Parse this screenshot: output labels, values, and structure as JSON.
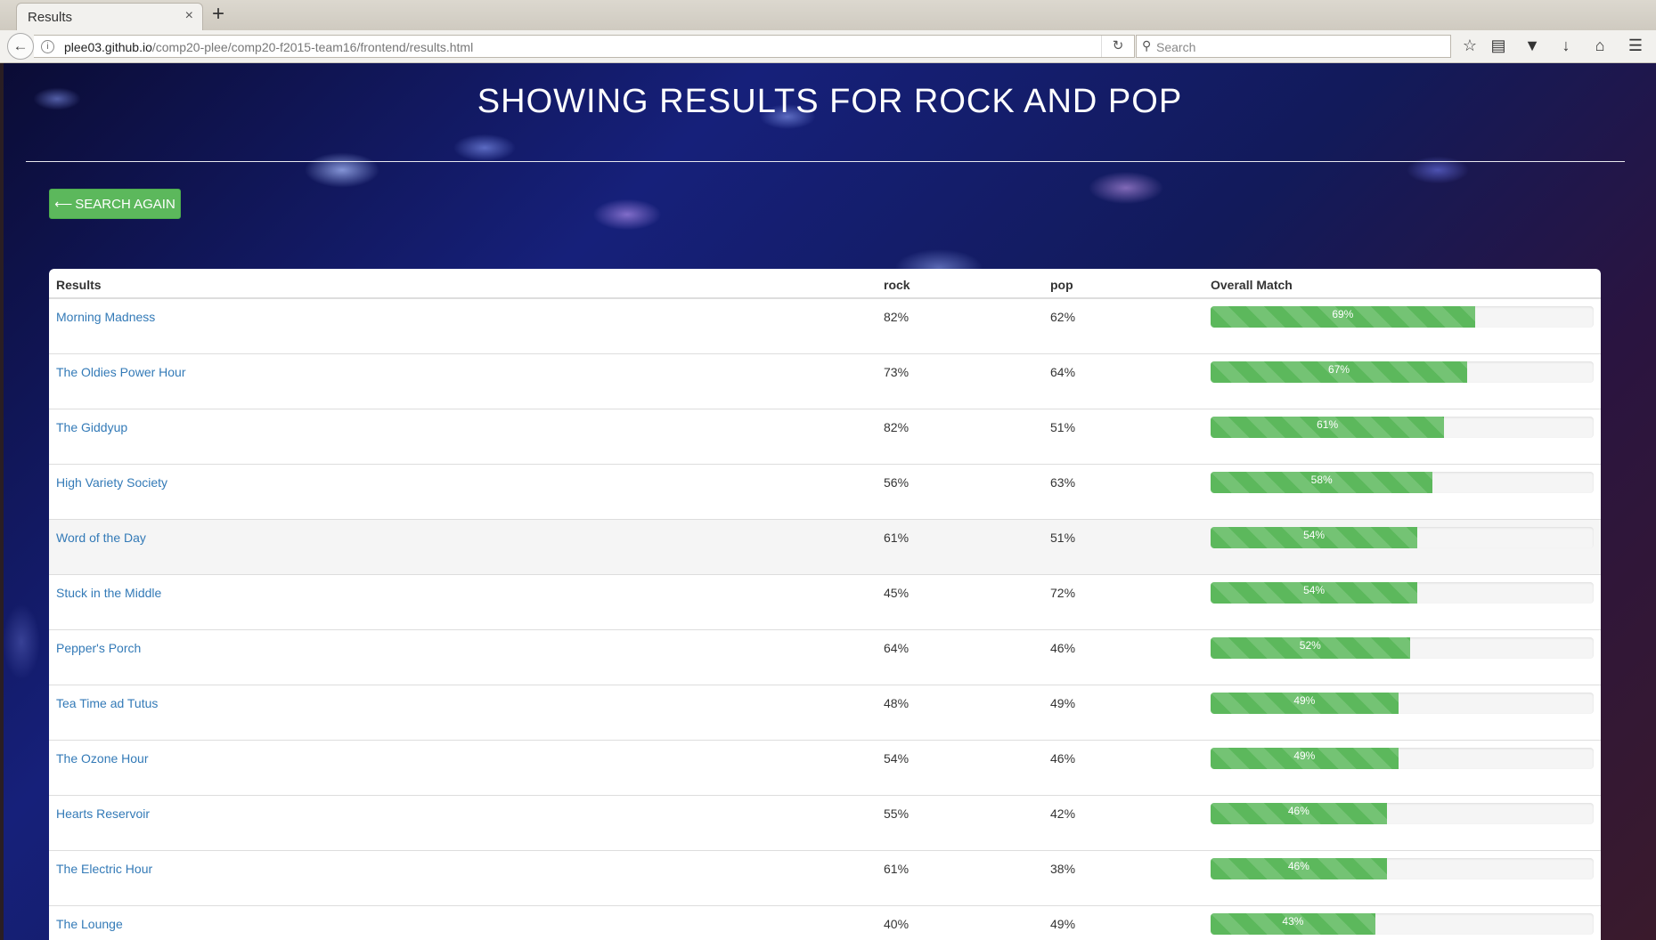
{
  "browser": {
    "tab_title": "Results",
    "tab_close": "×",
    "new_tab": "+",
    "url_host": "plee03.github.io",
    "url_path": "/comp20-plee/comp20-f2015-team16/frontend/results.html",
    "search_placeholder": "Search",
    "icons": [
      "back-arrow-icon",
      "info-icon",
      "reload-icon",
      "search-icon",
      "bookmark-star-icon",
      "reading-list-icon",
      "pocket-icon",
      "download-icon",
      "home-icon",
      "menu-icon"
    ]
  },
  "page": {
    "header": "SHOWING RESULTS FOR ROCK AND POP",
    "search_again_label": "SEARCH AGAIN",
    "search_again_icon": "arrow-left-icon",
    "table": {
      "columns": [
        "Results",
        "rock",
        "pop",
        "Overall Match"
      ],
      "rows": [
        {
          "name": "Morning Madness",
          "rock": "82%",
          "pop": "62%",
          "match": "69%",
          "match_value": 69
        },
        {
          "name": "The Oldies Power Hour",
          "rock": "73%",
          "pop": "64%",
          "match": "67%",
          "match_value": 67
        },
        {
          "name": "The Giddyup",
          "rock": "82%",
          "pop": "51%",
          "match": "61%",
          "match_value": 61
        },
        {
          "name": "High Variety Society",
          "rock": "56%",
          "pop": "63%",
          "match": "58%",
          "match_value": 58
        },
        {
          "name": "Word of the Day",
          "rock": "61%",
          "pop": "51%",
          "match": "54%",
          "match_value": 54
        },
        {
          "name": "Stuck in the Middle",
          "rock": "45%",
          "pop": "72%",
          "match": "54%",
          "match_value": 54
        },
        {
          "name": "Pepper's Porch",
          "rock": "64%",
          "pop": "46%",
          "match": "52%",
          "match_value": 52
        },
        {
          "name": "Tea Time ad Tutus",
          "rock": "48%",
          "pop": "49%",
          "match": "49%",
          "match_value": 49
        },
        {
          "name": "The Ozone Hour",
          "rock": "54%",
          "pop": "46%",
          "match": "49%",
          "match_value": 49
        },
        {
          "name": "Hearts Reservoir",
          "rock": "55%",
          "pop": "42%",
          "match": "46%",
          "match_value": 46
        },
        {
          "name": "The Electric Hour",
          "rock": "61%",
          "pop": "38%",
          "match": "46%",
          "match_value": 46
        },
        {
          "name": "The Lounge",
          "rock": "40%",
          "pop": "49%",
          "match": "43%",
          "match_value": 43
        }
      ],
      "hovered_row": 4
    },
    "colors": {
      "progress_bar": "#5cb85c",
      "link": "#337ab7",
      "button": "#5cb85c"
    }
  }
}
